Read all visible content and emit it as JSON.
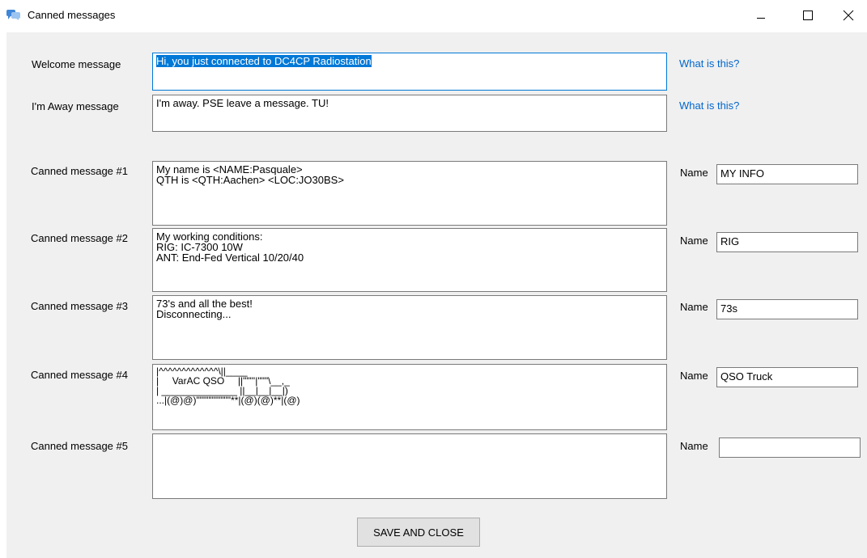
{
  "window": {
    "title": "Canned messages",
    "icon": "chat-bubbles-icon",
    "controls": [
      "minimize-icon",
      "maximize-icon",
      "close-icon"
    ]
  },
  "welcome": {
    "label": "Welcome message",
    "value": "Hi, you just connected to DC4CP Radiostation",
    "selected": true,
    "link": "What is this?"
  },
  "away": {
    "label": "I'm Away message",
    "value": "I'm away. PSE leave a message. TU!",
    "link": "What is this?"
  },
  "canned": [
    {
      "label": "Canned message #1",
      "value": "My name is <NAME:Pasquale>\nQTH is <QTH:Aachen> <LOC:JO30BS>",
      "name_label": "Name",
      "name": "MY INFO"
    },
    {
      "label": "Canned message #2",
      "value": "My working conditions:\nRIG: IC-7300 10W\nANT: End-Fed Vertical 10/20/40",
      "name_label": "Name",
      "name": "RIG"
    },
    {
      "label": "Canned message #3",
      "value": "73's and all the best!\nDisconnecting...",
      "name_label": "Name",
      "name": "73s"
    },
    {
      "label": "Canned message #4",
      "value": "|^^^^^^^^^^^^^\\||____\n|     VarAC QSO     ||\"\"\"'|\"\"\"\\__,_\n| ______________ ||__|__|__|)\n...|(@)@)\"\"\"\"\"\"\"\"\"\"**|(@)(@)**|(@)",
      "name_label": "Name",
      "name": "QSO Truck"
    },
    {
      "label": "Canned message #5",
      "value": "",
      "name_label": "Name",
      "name": ""
    }
  ],
  "save_button": "SAVE AND CLOSE"
}
